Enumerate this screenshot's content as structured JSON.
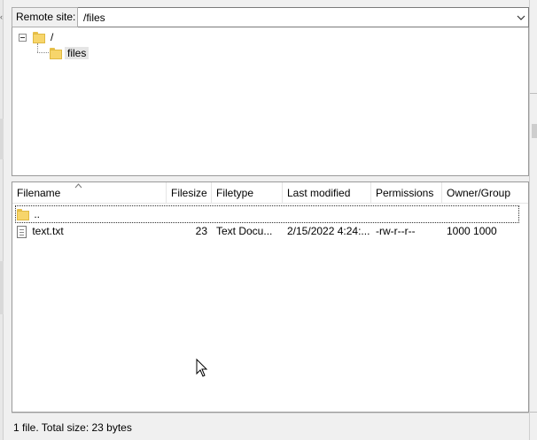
{
  "remote_site": {
    "label": "Remote site:",
    "path": "/files"
  },
  "tree": {
    "root": {
      "label": "/",
      "icon": "folder-icon"
    },
    "child": {
      "label": "files",
      "icon": "folder-icon"
    }
  },
  "file_list": {
    "columns": [
      "Filename",
      "Filesize",
      "Filetype",
      "Last modified",
      "Permissions",
      "Owner/Group"
    ],
    "parent_entry": {
      "name": "..",
      "icon": "folder-icon"
    },
    "rows": [
      {
        "name": "text.txt",
        "icon": "document-icon",
        "size": "23",
        "type": "Text Docu...",
        "modified": "2/15/2022 4:24:...",
        "permissions": "-rw-r--r--",
        "owner": "1000 1000"
      }
    ]
  },
  "status": {
    "text": "1 file. Total size: 23 bytes"
  },
  "colors": {
    "folder": "#f7d56b",
    "border": "#9a9a9a",
    "background": "#f0f0f0"
  }
}
